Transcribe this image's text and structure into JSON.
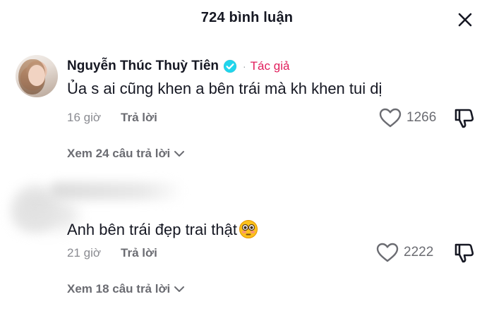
{
  "header": {
    "title": "724 bình luận",
    "close_icon": "close-icon"
  },
  "comments": [
    {
      "username": "Nguyễn Thúc Thuỳ Tiên",
      "verified": true,
      "separator": "·",
      "author_tag": "Tác giả",
      "text": "Ủa s ai cũng khen a bên trái mà kh khen tui dị",
      "time": "16 giờ",
      "reply_label": "Trả lời",
      "like_count": "1266",
      "view_replies": "Xem 24 câu trả lời"
    },
    {
      "username": "",
      "text": "Anh bên trái đẹp trai thật",
      "emoji": "flushed-face-icon",
      "time": "21 giờ",
      "reply_label": "Trả lời",
      "like_count": "2222",
      "view_replies": "Xem 18 câu trả lời"
    }
  ],
  "colors": {
    "author_tag": "#e11d5b",
    "verified": "#20d5ec",
    "text": "#161823",
    "muted": "#8a8b91"
  }
}
